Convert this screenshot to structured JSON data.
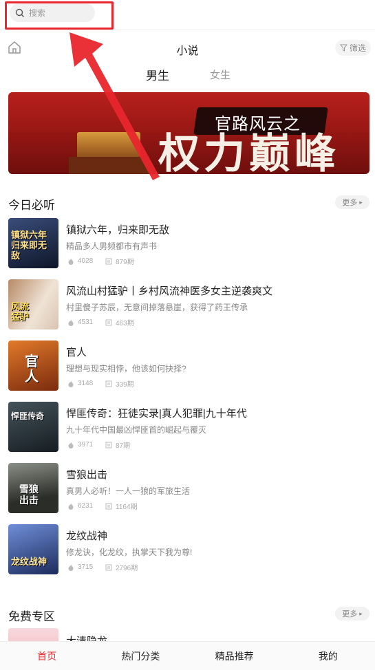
{
  "search": {
    "placeholder": "搜索"
  },
  "header": {
    "title": "小说",
    "filter_label": "筛选"
  },
  "gender_tabs": [
    {
      "label": "男生",
      "active": true
    },
    {
      "label": "女生",
      "active": false
    }
  ],
  "banner": {
    "line1": "官路风云之",
    "line2": "权力巅峰"
  },
  "today": {
    "title": "今日必听",
    "more_label": "更多",
    "books": [
      {
        "title": "镇狱六年，归来即无敌",
        "desc": "精品多人男频都市有声书",
        "plays": "4028",
        "episodes": "879期",
        "cover_text": "镇狱六年归来即无敌",
        "cover_color": "#1b2a4a"
      },
      {
        "title": "风流山村猛驴丨乡村风流神医多女主逆袭爽文",
        "desc": "村里傻子苏辰，无意间掉落悬崖，获得了药王传承",
        "plays": "4531",
        "episodes": "463期",
        "cover_text": "风流猛驴",
        "cover_color": "#c7a48a"
      },
      {
        "title": "官人",
        "desc": "理想与现实相悖，他该如何抉择?",
        "plays": "3148",
        "episodes": "339期",
        "cover_text": "官人",
        "cover_color": "#c2521d"
      },
      {
        "title": "悍匪传奇：狂徒实录|真人犯罪|九十年代",
        "desc": "九十年代中国最凶悍匪首的崛起与覆灭",
        "plays": "3971",
        "episodes": "87期",
        "cover_text": "悍匪传奇",
        "cover_color": "#2f3c44"
      },
      {
        "title": "雪狼出击",
        "desc": "真男人必听！一人一狼的军旅生活",
        "plays": "6231",
        "episodes": "1164期",
        "cover_text": "雪狼出击",
        "cover_color": "#3b3f3a"
      },
      {
        "title": "龙纹战神",
        "desc": "修龙诀，化龙纹，执掌天下我为尊!",
        "plays": "3715",
        "episodes": "2796期",
        "cover_text": "龙纹战神",
        "cover_color": "#20305c"
      }
    ]
  },
  "free": {
    "title": "免费专区",
    "more_label": "更多",
    "first_title": "大清隐龙"
  },
  "tabbar": [
    {
      "label": "首页",
      "active": true
    },
    {
      "label": "热门分类",
      "active": false
    },
    {
      "label": "精品推荐",
      "active": false
    },
    {
      "label": "我的",
      "active": false
    }
  ],
  "colors": {
    "accent": "#e8262c",
    "annotation": "#e8262c"
  },
  "icons": [
    "search-icon",
    "home-icon",
    "filter-icon",
    "fire-icon",
    "list-icon",
    "chevron-right-icon",
    "arrow-annotation"
  ]
}
